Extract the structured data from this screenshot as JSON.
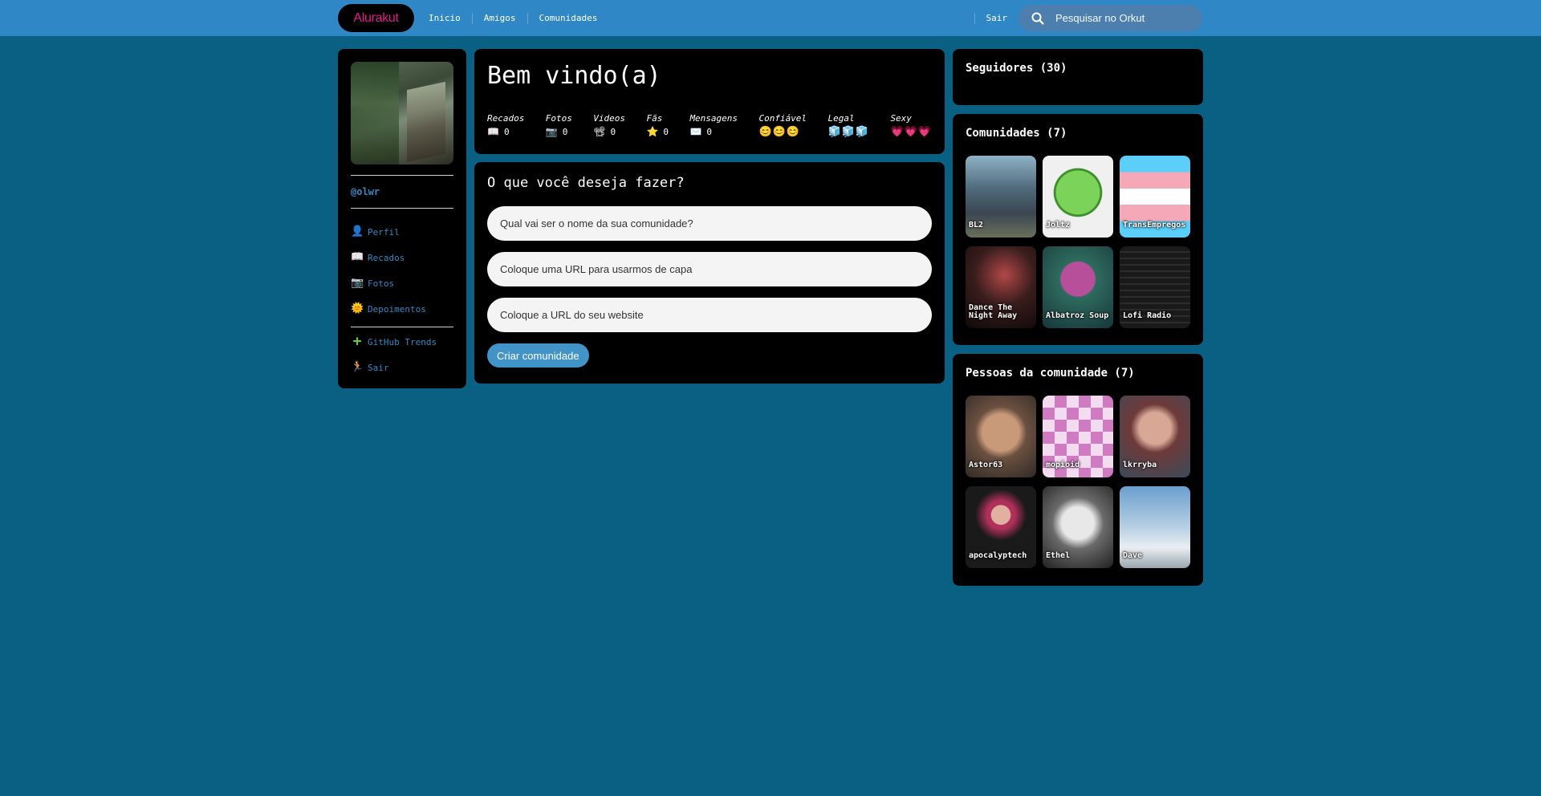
{
  "topbar": {
    "logo": "Alurakut",
    "nav": [
      "Inicio",
      "Amigos",
      "Comunidades"
    ],
    "logout": "Sair",
    "search_placeholder": "Pesquisar no Orkut"
  },
  "sidebar": {
    "username": "@olwr",
    "menu": [
      {
        "label": "Perfil",
        "icon": "person-icon"
      },
      {
        "label": "Recados",
        "icon": "book-icon"
      },
      {
        "label": "Fotos",
        "icon": "camera-icon"
      },
      {
        "label": "Depoimentos",
        "icon": "sun-icon"
      },
      {
        "label": "GitHub Trends",
        "icon": "plus-icon"
      },
      {
        "label": "Sair",
        "icon": "exit-icon"
      }
    ]
  },
  "welcome": {
    "title": "Bem vindo(a)",
    "stats": [
      {
        "label": "Recados",
        "value": "0",
        "icon": "book-icon"
      },
      {
        "label": "Fotos",
        "value": "0",
        "icon": "camera-icon"
      },
      {
        "label": "Videos",
        "value": "0",
        "icon": "video-icon"
      },
      {
        "label": "Fãs",
        "value": "0",
        "icon": "star-icon"
      },
      {
        "label": "Mensagens",
        "value": "0",
        "icon": "mail-icon"
      },
      {
        "label": "Confiável",
        "rating": "😊😊😊"
      },
      {
        "label": "Legal",
        "rating": "🧊🧊🧊"
      },
      {
        "label": "Sexy",
        "rating": "💗💗💗"
      }
    ]
  },
  "form": {
    "title": "O que você deseja fazer?",
    "fields": [
      "Qual vai ser o nome da sua comunidade?",
      "Coloque uma URL para usarmos de capa",
      "Coloque a URL do seu website"
    ],
    "submit": "Criar comunidade"
  },
  "followers": {
    "title": "Seguidores (30)"
  },
  "communities": {
    "title": "Comunidades (7)",
    "items": [
      "BL2",
      "Joltz",
      "TransEmpregos",
      "Dance The Night Away",
      "Albatroz Soup",
      "Lofi Radio"
    ]
  },
  "people": {
    "title": "Pessoas da comunidade (7)",
    "items": [
      "Astor63",
      "mopioid",
      "lkrryba",
      "apocalyptech",
      "Ethel",
      "Dave"
    ]
  },
  "colors": {
    "background": "#0a6082",
    "topbar": "#2f88c5",
    "accent": "#308bc5",
    "logo": "#e3198e"
  }
}
